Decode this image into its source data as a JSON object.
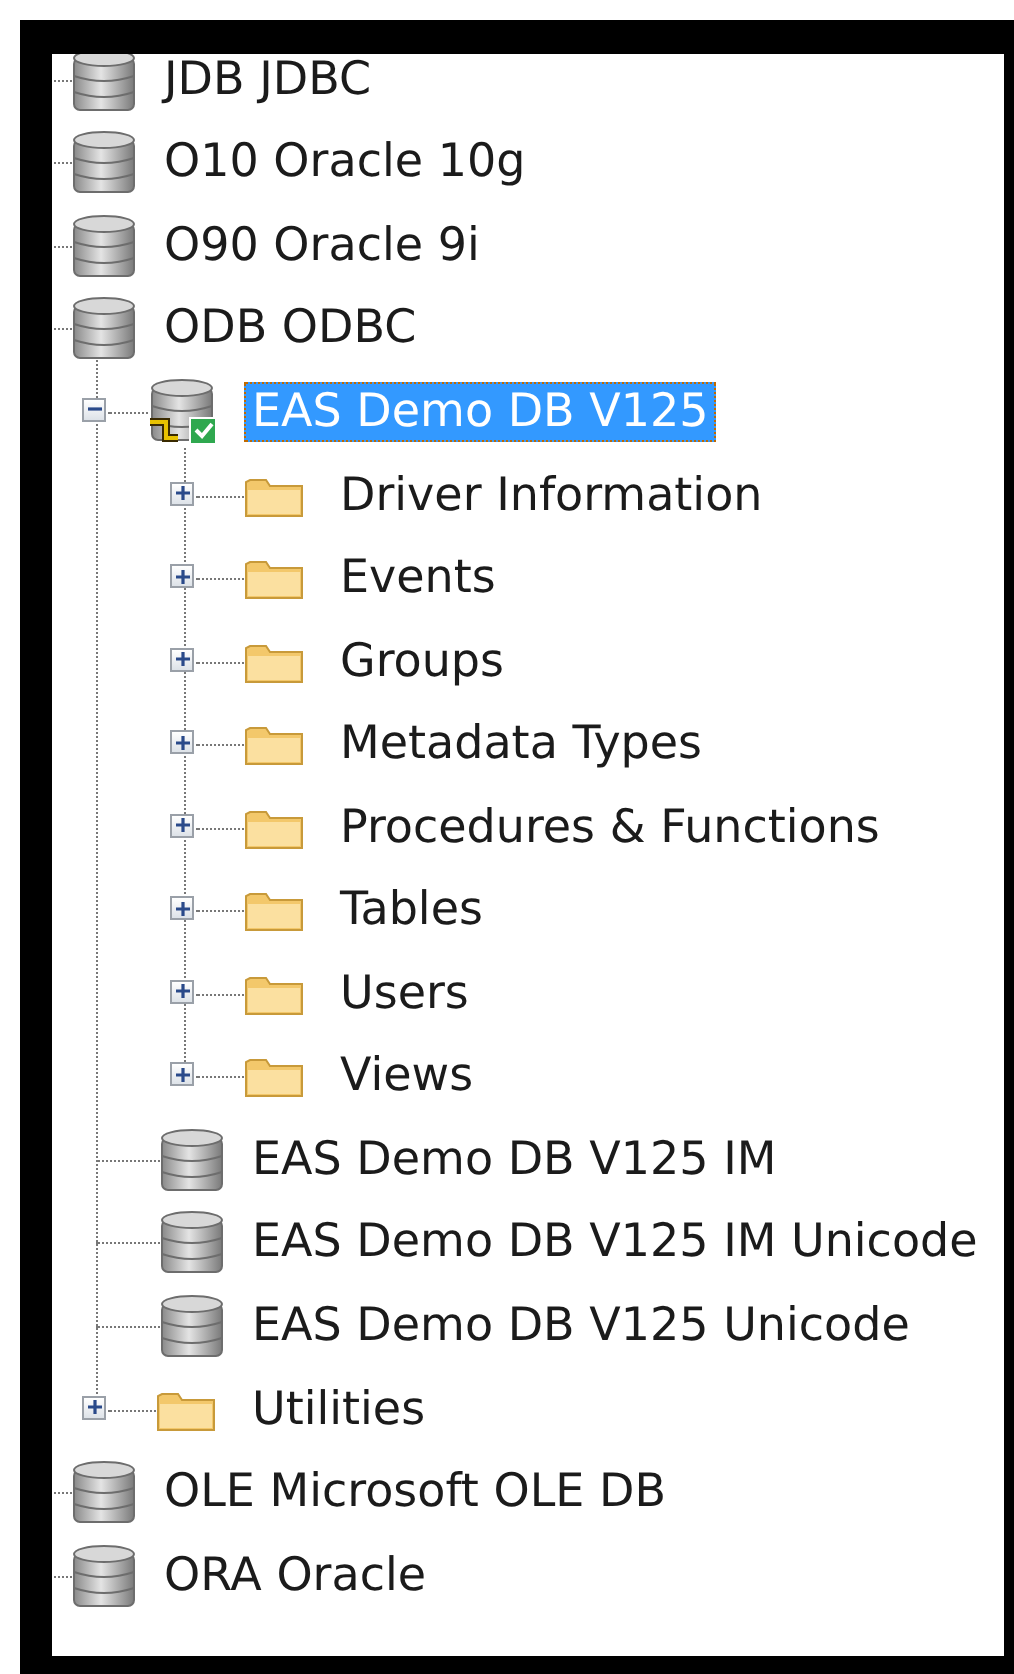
{
  "tree": {
    "items": [
      {
        "label": "JDB JDBC",
        "kind": "database",
        "selected": false
      },
      {
        "label": "O10 Oracle 10g",
        "kind": "database",
        "selected": false
      },
      {
        "label": "O90 Oracle 9i",
        "kind": "database",
        "selected": false
      },
      {
        "label": "ODB ODBC",
        "kind": "database",
        "selected": false,
        "children": [
          {
            "label": "EAS Demo DB V125",
            "kind": "connected-database",
            "selected": true,
            "expanded": true,
            "children": [
              {
                "label": "Driver Information",
                "kind": "folder",
                "selected": false,
                "expanded": false
              },
              {
                "label": "Events",
                "kind": "folder",
                "selected": false,
                "expanded": false
              },
              {
                "label": "Groups",
                "kind": "folder",
                "selected": false,
                "expanded": false
              },
              {
                "label": "Metadata Types",
                "kind": "folder",
                "selected": false,
                "expanded": false
              },
              {
                "label": "Procedures & Functions",
                "kind": "folder",
                "selected": false,
                "expanded": false
              },
              {
                "label": "Tables",
                "kind": "folder",
                "selected": false,
                "expanded": false
              },
              {
                "label": "Users",
                "kind": "folder",
                "selected": false,
                "expanded": false
              },
              {
                "label": "Views",
                "kind": "folder",
                "selected": false,
                "expanded": false
              }
            ]
          },
          {
            "label": "EAS Demo DB V125 IM",
            "kind": "database",
            "selected": false
          },
          {
            "label": "EAS Demo DB V125 IM Unicode",
            "kind": "database",
            "selected": false
          },
          {
            "label": "EAS Demo DB V125 Unicode",
            "kind": "database",
            "selected": false
          },
          {
            "label": "Utilities",
            "kind": "folder",
            "selected": false,
            "expanded": false
          }
        ]
      },
      {
        "label": "OLE Microsoft OLE DB",
        "kind": "database",
        "selected": false
      },
      {
        "label": "ORA Oracle",
        "kind": "database",
        "selected": false
      }
    ]
  }
}
